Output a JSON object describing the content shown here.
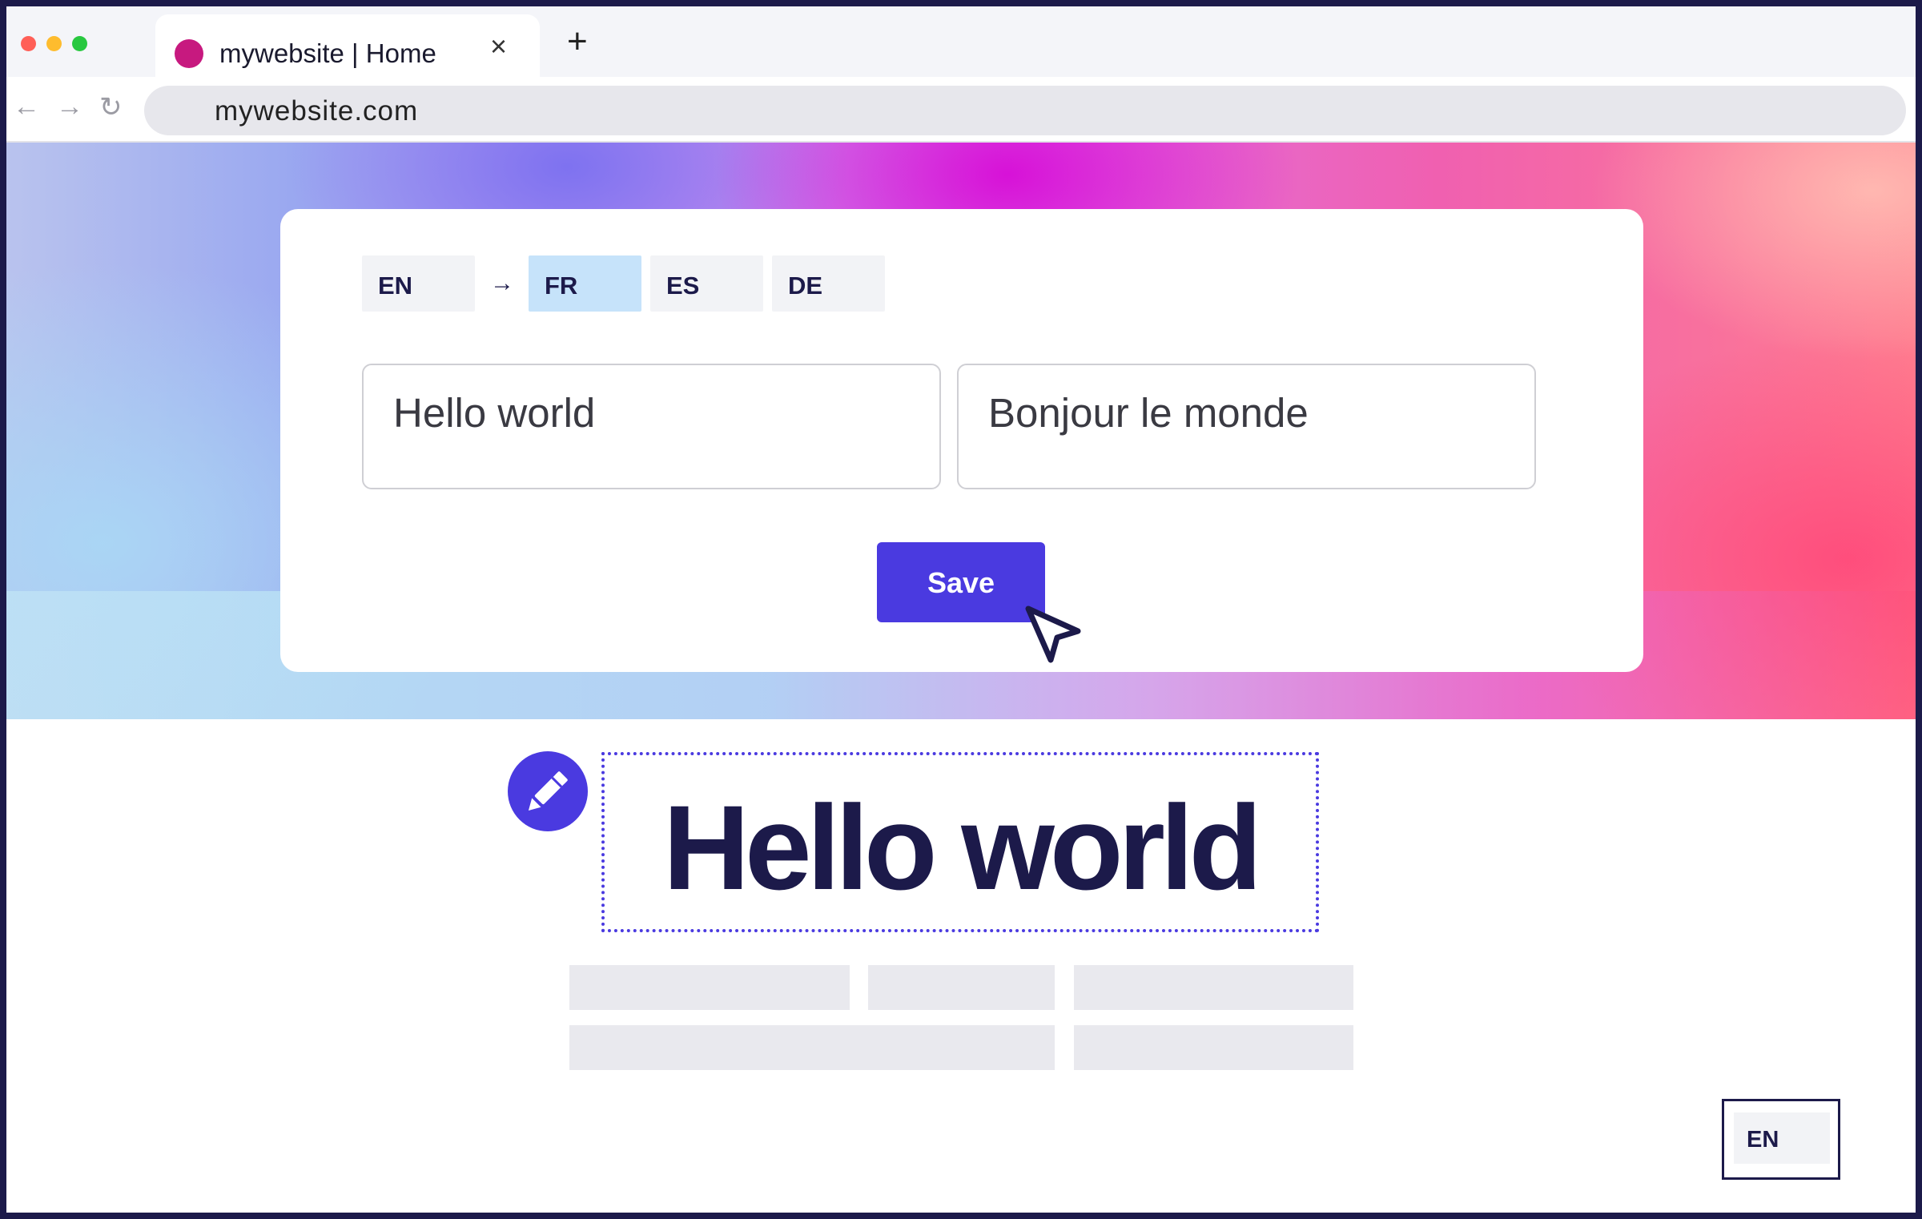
{
  "browser": {
    "tab_title": "mywebsite | Home",
    "tab_close": "×",
    "new_tab": "+",
    "url": "mywebsite.com",
    "back": "←",
    "forward": "→",
    "reload": "↻",
    "traffic_lights": [
      "#ff5f57",
      "#febc2e",
      "#28c840"
    ],
    "favicon_color": "#c7197f"
  },
  "translator": {
    "source_language": "EN",
    "arrow": "→",
    "target_languages": [
      "FR",
      "ES",
      "DE"
    ],
    "active_target": "FR",
    "source_text": "Hello world",
    "translated_text": "Bonjour le monde",
    "save_label": "Save",
    "accent_color": "#4a3ae0"
  },
  "page": {
    "headline": "Hello world",
    "edit_icon": "pencil-icon",
    "language_switcher": "EN"
  }
}
